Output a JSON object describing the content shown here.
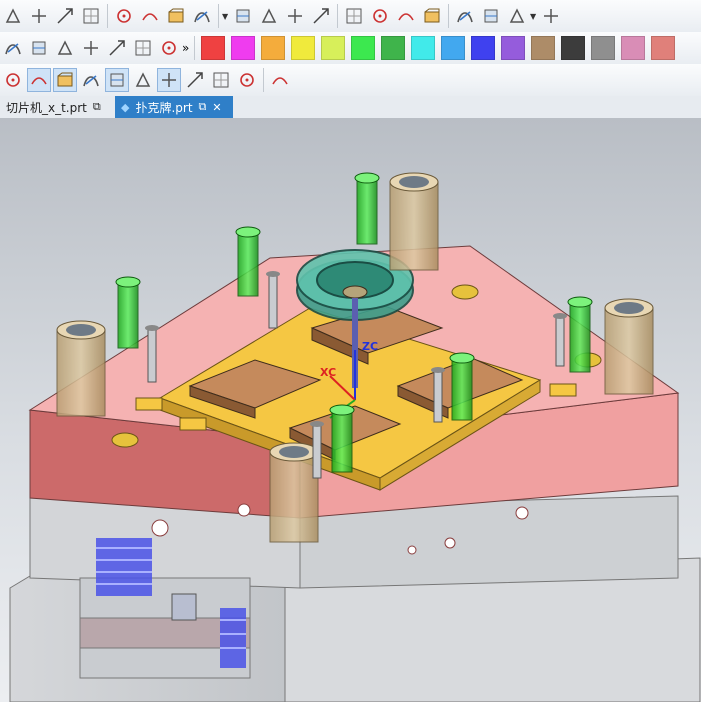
{
  "toolbar_rows": [
    {
      "icons": [
        "sweep-icon",
        "face-blend-icon",
        "trim-icon",
        "extend-icon",
        "curve-icon",
        "arrow-icon",
        "grid-icon",
        "transform-icon",
        "line-icon",
        "dimension-icon",
        "align-icon",
        "split-icon",
        "measure-icon",
        "ladder-icon",
        "section-icon",
        "mold-icon",
        "parts-icon",
        "library-icon",
        "box-icon",
        "pencil-box-icon"
      ]
    },
    {
      "icons": [
        "curve-s-icon",
        "surface-icon",
        "blend-shape-icon",
        "shell-icon",
        "flag-icon",
        "sweep-arrow-icon",
        "wave-icon"
      ]
    },
    {
      "icons": [
        "axis-icon",
        "spline-icon",
        "wave-curve-icon",
        "intersect-icon",
        "circle-dot-icon",
        "circle-target-icon",
        "crosshair-icon",
        "line-draw-icon",
        "eraser-icon",
        "paint-icon",
        "table-icon"
      ]
    }
  ],
  "more_indicator": "»",
  "colors": [
    "#ef4141",
    "#ef3cef",
    "#f4ac3c",
    "#f0ea3c",
    "#d7ef5a",
    "#3ce84f",
    "#3fb44b",
    "#41eaea",
    "#42a8ef",
    "#3f41ef",
    "#955cdc",
    "#ad8c68",
    "#3c3c3c",
    "#8f8f8f",
    "#d98db6",
    "#e0807a"
  ],
  "tabs": [
    {
      "label": "切片机_x_t.prt",
      "active": false
    },
    {
      "label": "扑克牌.prt",
      "active": true
    }
  ],
  "close_icon": "✕",
  "axis": {
    "zc": "ZC",
    "xc": "XC"
  }
}
